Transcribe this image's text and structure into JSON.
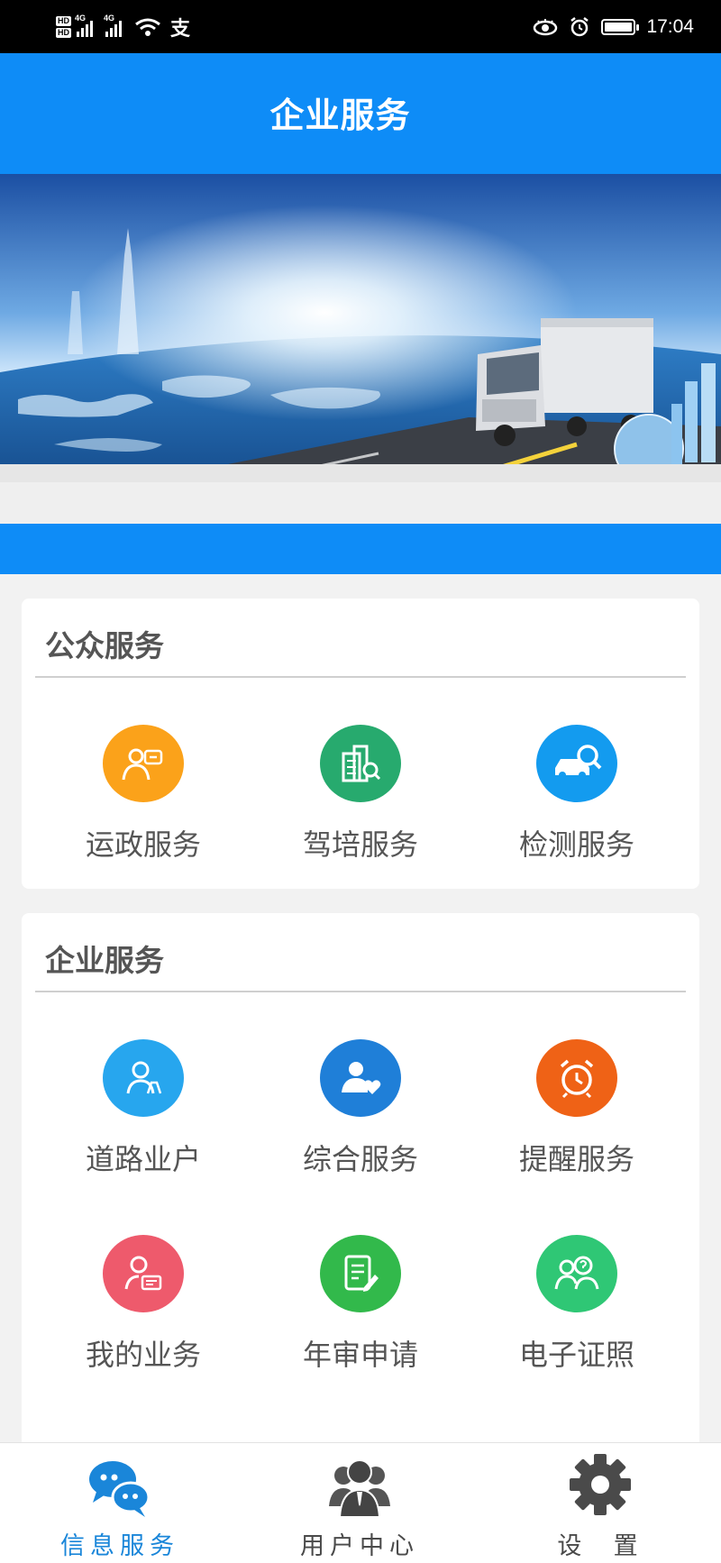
{
  "status_bar": {
    "hd_1": "HD",
    "hd_2": "HD",
    "net_1": "4G",
    "net_2": "4G",
    "extra_glyph": "支",
    "time": "17:04"
  },
  "header": {
    "title": "企业服务"
  },
  "banner": {
    "description_icon": "truck-banner-image"
  },
  "public_services": {
    "title": "公众服务",
    "items": [
      {
        "label": "运政服务",
        "icon": "certificate-icon",
        "color": "#fba21a"
      },
      {
        "label": "驾培服务",
        "icon": "building-search-icon",
        "color": "#27aa6e"
      },
      {
        "label": "检测服务",
        "icon": "car-inspection-icon",
        "color": "#139bef"
      }
    ]
  },
  "enterprise_services": {
    "title": "企业服务",
    "items": [
      {
        "label": "道路业户",
        "icon": "road-user-icon",
        "color": "#27a6ee"
      },
      {
        "label": "综合服务",
        "icon": "user-heart-icon",
        "color": "#1f7fd8"
      },
      {
        "label": "提醒服务",
        "icon": "alarm-clock-icon",
        "color": "#ef6216"
      },
      {
        "label": "我的业务",
        "icon": "user-card-icon",
        "color": "#ee5a6c"
      },
      {
        "label": "年审申请",
        "icon": "document-edit-icon",
        "color": "#32b94b"
      },
      {
        "label": "电子证照",
        "icon": "people-question-icon",
        "color": "#2fc775"
      }
    ]
  },
  "bottom_nav": {
    "items": [
      {
        "label": "信息服务",
        "icon": "chat-bubbles-icon",
        "active": true,
        "color": "#1a86d9"
      },
      {
        "label": "用户中心",
        "icon": "users-group-icon",
        "active": false,
        "color": "#4a4a4a"
      },
      {
        "label": "设  置",
        "icon": "gear-icon",
        "active": false,
        "color": "#4a4a4a"
      }
    ]
  }
}
